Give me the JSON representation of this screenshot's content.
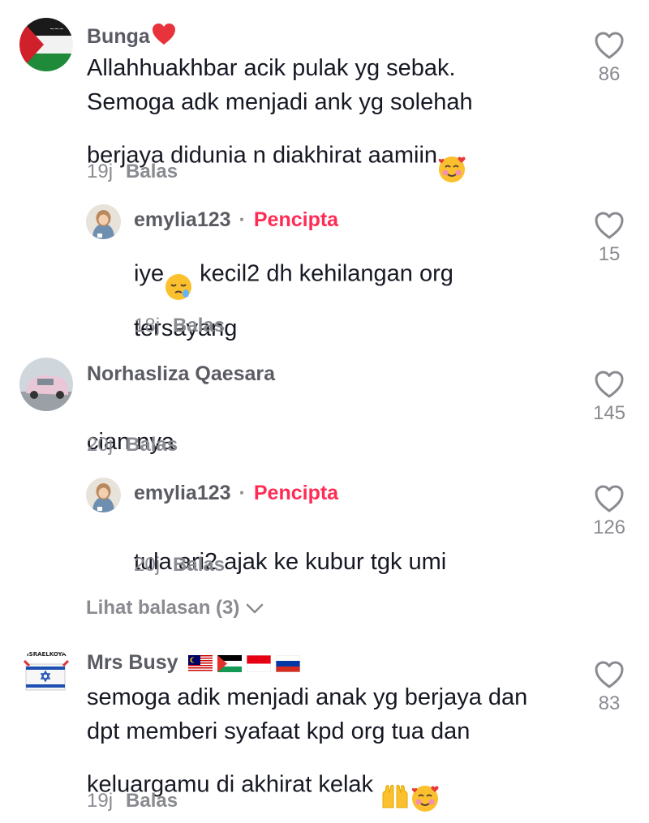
{
  "comments": [
    {
      "user": "Bunga",
      "text": "Allahhuakhbar acik pulak yg sebak.\nSemoga adk menjadi ank yg solehah\nberjaya didunia n diakhirat aamiin",
      "time": "19j",
      "reply": "Balas",
      "likes": "86"
    },
    {
      "user": "emylia123",
      "creator_label": "Pencipta",
      "text_a": "iye",
      "text_b": " kecil2 dh kehilangan org\ntersayang",
      "time": "18j",
      "reply": "Balas",
      "likes": "15"
    },
    {
      "user": "Norhasliza Qaesara",
      "text": "cian nya",
      "time": "20j",
      "reply": "Balas",
      "likes": "145"
    },
    {
      "user": "emylia123",
      "creator_label": "Pencipta",
      "text": "tula ari2 ajak ke kubur tgk umi",
      "time": "20j",
      "reply": "Balas",
      "likes": "126"
    },
    {
      "user": "Mrs Busy",
      "text_a": "semoga adik menjadi anak yg berjaya dan\ndpt memberi syafaat kpd org tua dan\nkeluargamu di akhirat kelak ",
      "time": "19j",
      "reply": "Balas",
      "likes": "83",
      "avatar_text": "#ISRAELKOYAK"
    }
  ],
  "view_replies": "Lihat balasan (3)",
  "icons": {
    "heart": "heart-outline-icon",
    "chevron": "chevron-down-icon"
  },
  "colors": {
    "creator": "#fe2c55",
    "muted": "#8a8b91",
    "text": "#161823"
  }
}
